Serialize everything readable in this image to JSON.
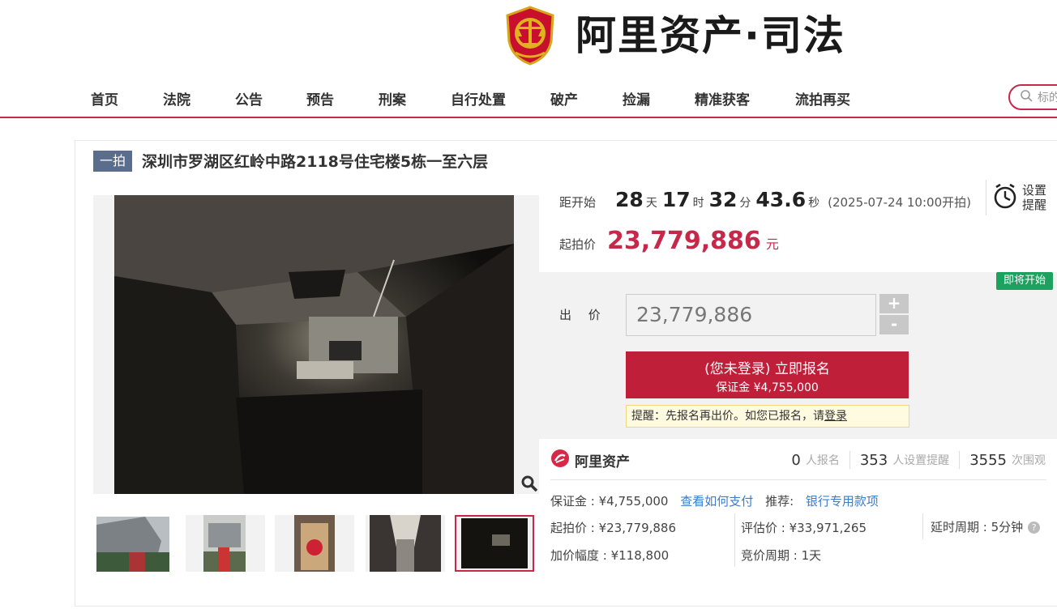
{
  "header": {
    "logo_text": "阿里资产·司法"
  },
  "nav": {
    "items": [
      "首页",
      "法院",
      "公告",
      "预告",
      "刑案",
      "自行处置",
      "破产",
      "捡漏",
      "精准获客",
      "流拍再买"
    ],
    "search_placeholder": "标的"
  },
  "item": {
    "tag": "一拍",
    "title": "深圳市罗湖区红岭中路2118号住宅楼5栋一至六层"
  },
  "countdown": {
    "label": "距开始",
    "days": "28",
    "days_unit": "天",
    "hours": "17",
    "hours_unit": "时",
    "minutes": "32",
    "minutes_unit": "分",
    "seconds": "43.6",
    "seconds_unit": "秒",
    "start_time": "(2025-07-24 10:00开拍)"
  },
  "reminder": {
    "label": "设置提醒"
  },
  "start_price": {
    "label": "起拍价",
    "value": "23,779,886",
    "unit": "元"
  },
  "bid": {
    "status_badge": "即将开始",
    "label": "出 价",
    "value": "23,779,886",
    "plus": "+",
    "minus": "-",
    "signup_line1": "(您未登录) 立即报名",
    "signup_line2": "保证金 ¥4,755,000",
    "tip_prefix": "提醒：先报名再出价。如您已报名，请",
    "tip_link": "登录"
  },
  "platform": {
    "name": "阿里资产"
  },
  "stats": {
    "signups": "0",
    "signups_label": "人报名",
    "reminders": "353",
    "reminders_label": "人设置提醒",
    "views": "3555",
    "views_label": "次围观"
  },
  "details": {
    "deposit": "保证金 : ¥4,755,000",
    "pay_link": "查看如何支付",
    "recommend_label": "推荐:",
    "recommend_link": "银行专用款项",
    "start_price": "起拍价 : ¥23,779,886",
    "valuation": "评估价 : ¥33,971,265",
    "delay": "延时周期 : 5分钟",
    "increment": "加价幅度 : ¥118,800",
    "bid_period": "竞价周期 : 1天"
  },
  "colors": {
    "brand_red": "#c6284a",
    "signup_red": "#c01f3a",
    "badge_green": "#1ea05f",
    "link_blue": "#3d7cc9"
  }
}
